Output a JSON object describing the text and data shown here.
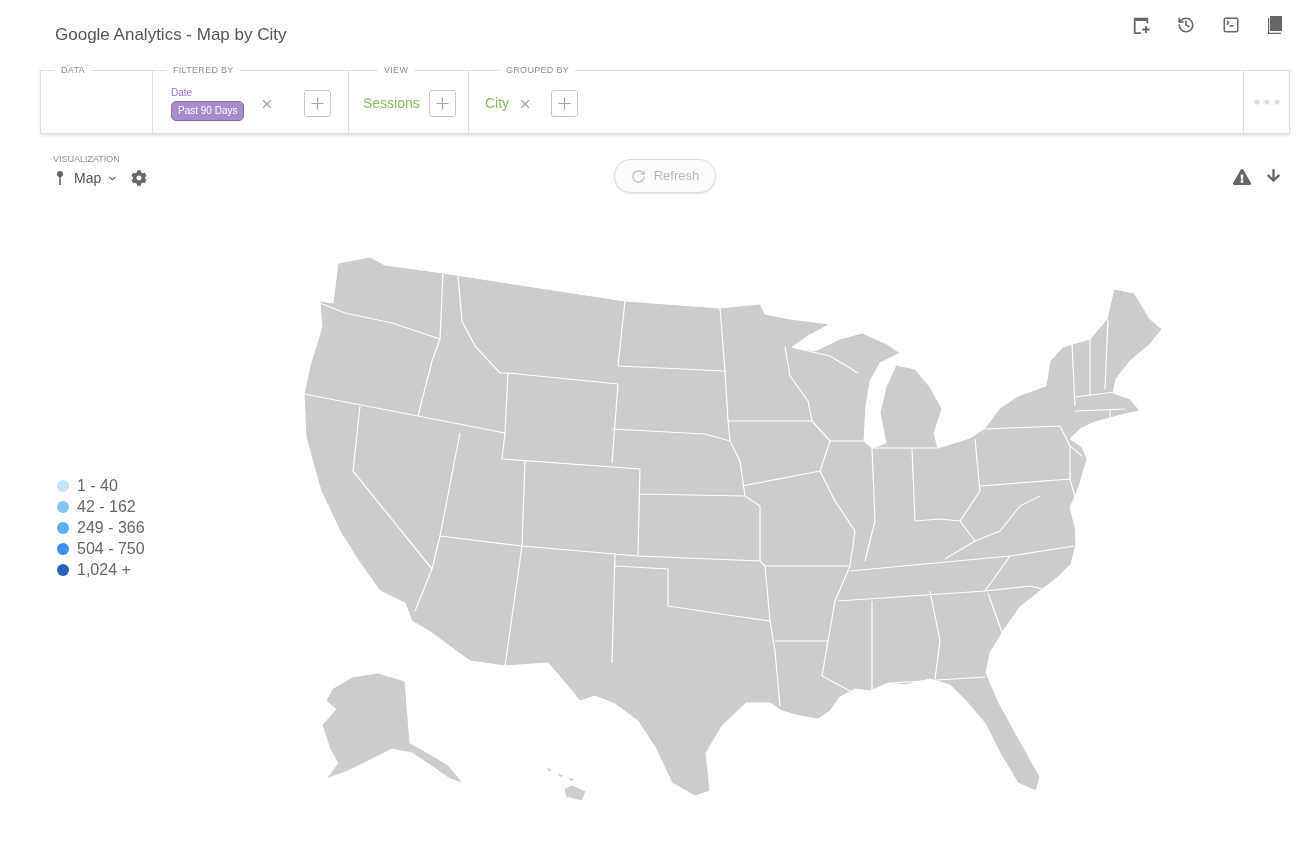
{
  "title": "Google Analytics - Map by City",
  "query": {
    "sections": [
      {
        "kind": "data",
        "label": "DATA"
      },
      {
        "kind": "filter",
        "label": "FILTERED BY",
        "filters": [
          {
            "field": "Date",
            "value": "Past 90 Days",
            "removable": true
          }
        ]
      },
      {
        "kind": "view",
        "label": "VIEW",
        "fields": [
          {
            "name": "Sessions",
            "removable": false
          }
        ]
      },
      {
        "kind": "group",
        "label": "GROUPED BY",
        "fields": [
          {
            "name": "City",
            "removable": true
          }
        ]
      },
      {
        "kind": "more"
      }
    ]
  },
  "visualization": {
    "label": "VISUALIZATION",
    "type": "Map"
  },
  "refresh": {
    "label": "Refresh",
    "disabled": true
  },
  "legend": [
    {
      "label": "1 - 40",
      "color": "#c5e3fa"
    },
    {
      "label": "42 - 162",
      "color": "#86c5f6"
    },
    {
      "label": "249 - 366",
      "color": "#5aaff6"
    },
    {
      "label": "504 - 750",
      "color": "#3d8ef0"
    },
    {
      "label": "1,024 +",
      "color": "#2660b8"
    }
  ]
}
